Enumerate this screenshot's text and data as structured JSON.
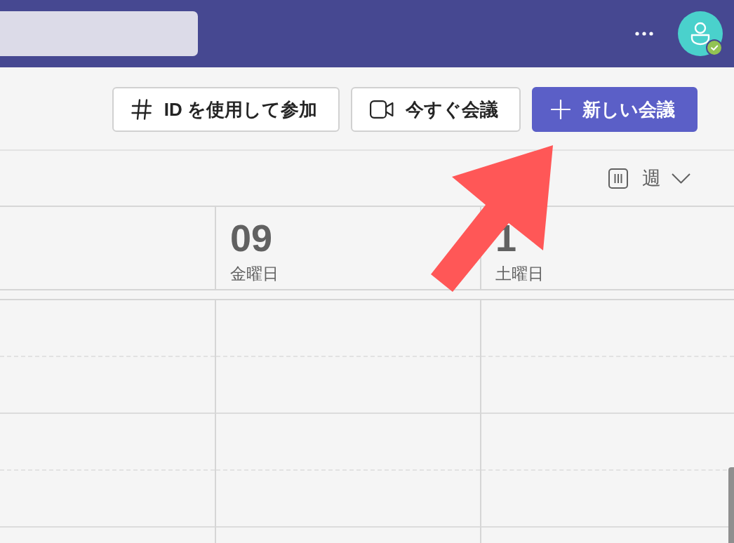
{
  "header": {
    "available": true
  },
  "toolbar": {
    "buttons": [
      {
        "kind": "join",
        "label": "ID を使用して参加",
        "primary": false
      },
      {
        "kind": "meet_now",
        "label": "今すぐ会議",
        "primary": false
      },
      {
        "kind": "new",
        "label": "新しい会議",
        "primary": true
      }
    ]
  },
  "view_switcher": {
    "label": "週"
  },
  "days": [
    {
      "day": "09",
      "weekday": "金曜日"
    },
    {
      "day": "1",
      "weekday": "土曜日"
    }
  ],
  "annotations": [
    {
      "kind": "arrow"
    }
  ]
}
